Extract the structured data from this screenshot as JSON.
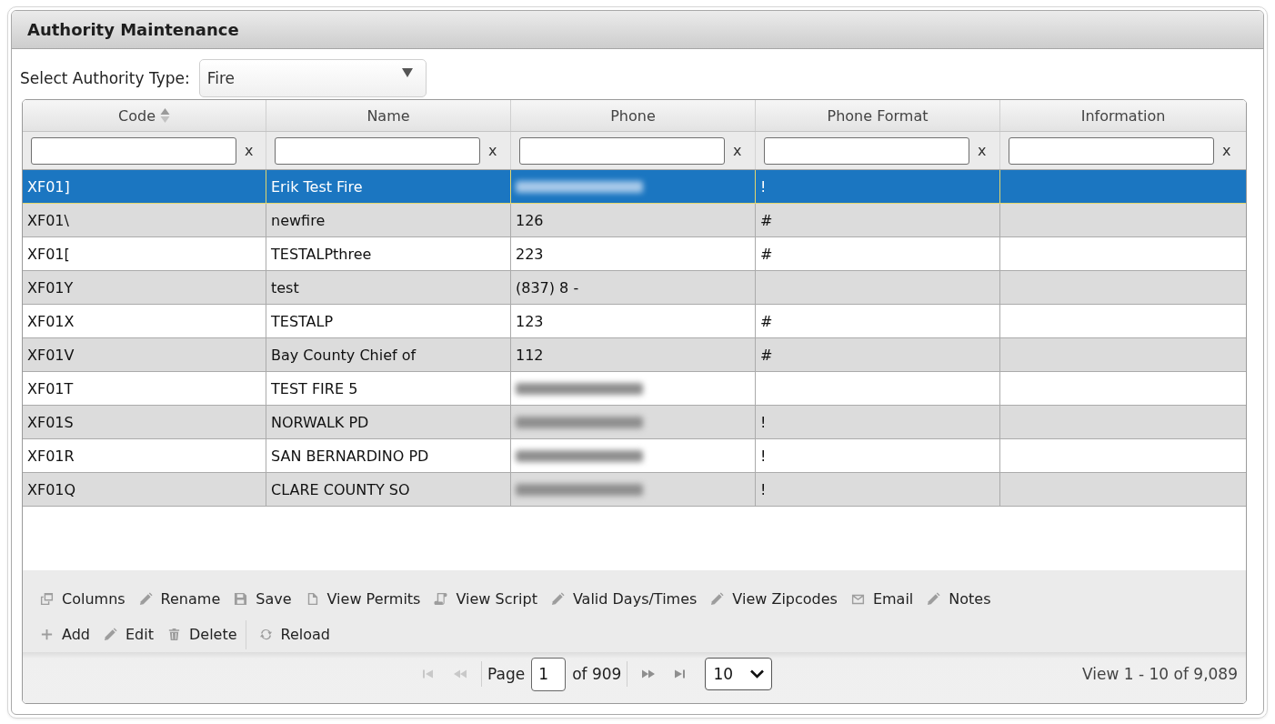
{
  "panel": {
    "title": "Authority Maintenance"
  },
  "authority_type": {
    "label": "Select Authority Type:",
    "value": "Fire"
  },
  "grid": {
    "columns": [
      {
        "label": "Code",
        "sortable": true
      },
      {
        "label": "Name",
        "sortable": false
      },
      {
        "label": "Phone",
        "sortable": false
      },
      {
        "label": "Phone Format",
        "sortable": false
      },
      {
        "label": "Information",
        "sortable": false
      }
    ],
    "filters": [
      {
        "clear": "x"
      },
      {
        "clear": "x"
      },
      {
        "clear": "x"
      },
      {
        "clear": "x"
      },
      {
        "clear": "x"
      }
    ],
    "rows": [
      {
        "selected": true,
        "code": "XF01]",
        "name": "Erik Test Fire",
        "phone_redacted": true,
        "phone_format": "!"
      },
      {
        "selected": false,
        "code": "XF01\\",
        "name": "newfire",
        "phone": "126",
        "phone_redacted": false,
        "phone_format": "#"
      },
      {
        "selected": false,
        "code": "XF01[",
        "name": "TESTALPthree",
        "phone": "223",
        "phone_redacted": false,
        "phone_format": "#"
      },
      {
        "selected": false,
        "code": "XF01Y",
        "name": "test",
        "phone": "(837) 8 -",
        "phone_redacted": false
      },
      {
        "selected": false,
        "code": "XF01X",
        "name": "TESTALP",
        "phone": "123",
        "phone_redacted": false,
        "phone_format": "#"
      },
      {
        "selected": false,
        "code": "XF01V",
        "name": "Bay County Chief of",
        "phone": "112",
        "phone_redacted": false,
        "phone_format": "#"
      },
      {
        "selected": false,
        "code": "XF01T",
        "name": "TEST FIRE 5",
        "phone_redacted": true
      },
      {
        "selected": false,
        "code": "XF01S",
        "name": "NORWALK PD",
        "phone_redacted": true,
        "phone_format": "!"
      },
      {
        "selected": false,
        "code": "XF01R",
        "name": "SAN BERNARDINO PD",
        "phone_redacted": true,
        "phone_format": "!"
      },
      {
        "selected": false,
        "code": "XF01Q",
        "name": "CLARE COUNTY SO",
        "phone_redacted": true,
        "phone_format": "!"
      }
    ]
  },
  "toolbar": {
    "rows": [
      {
        "groups": [
          [
            {
              "kind": "columns",
              "label": "Columns"
            },
            {
              "kind": "pencil",
              "label": "Rename"
            },
            {
              "kind": "save",
              "label": "Save"
            },
            {
              "kind": "document",
              "label": "View Permits"
            },
            {
              "kind": "scroll",
              "label": "View Script"
            },
            {
              "kind": "pencil",
              "label": "Valid Days/Times"
            },
            {
              "kind": "pencil",
              "label": "View Zipcodes"
            },
            {
              "kind": "envelope",
              "label": "Email"
            },
            {
              "kind": "pencil",
              "label": "Notes"
            }
          ]
        ]
      },
      {
        "groups": [
          [
            {
              "kind": "plus",
              "label": "Add"
            },
            {
              "kind": "pencil",
              "label": "Edit"
            },
            {
              "kind": "trash",
              "label": "Delete"
            }
          ],
          [
            {
              "kind": "refresh",
              "label": "Reload"
            }
          ]
        ]
      }
    ]
  },
  "pager": {
    "nav_back": [
      {
        "kind": "first",
        "disabled": true
      },
      {
        "kind": "prev",
        "disabled": true
      }
    ],
    "page_label": "Page",
    "page": "1",
    "total_label": "of 909",
    "nav_forward": [
      {
        "kind": "next",
        "disabled": false
      },
      {
        "kind": "last",
        "disabled": false
      }
    ],
    "page_size": "10",
    "summary": "View 1 - 10 of 9,089"
  }
}
